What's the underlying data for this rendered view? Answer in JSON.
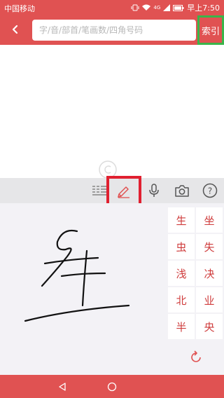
{
  "status_bar": {
    "carrier": "中国移动",
    "time": "早上7:50",
    "signal_label": "4G"
  },
  "header": {
    "search": {
      "placeholder": "字/音/部首/笔画数/四角号码",
      "value": ""
    },
    "index_button_label": "索引"
  },
  "toolbar": {
    "icons": [
      "keyboard-icon",
      "pencil-icon",
      "microphone-icon",
      "camera-icon",
      "help-icon"
    ],
    "help_label": "?"
  },
  "handwriting": {
    "candidates": [
      "生",
      "坐",
      "虫",
      "失",
      "浅",
      "决",
      "北",
      "业",
      "半",
      "央"
    ]
  },
  "colors": {
    "brand": "#e05252",
    "highlight_green": "#3ab54a",
    "highlight_red": "#e02030",
    "candidate_text": "#cf3c3c"
  }
}
